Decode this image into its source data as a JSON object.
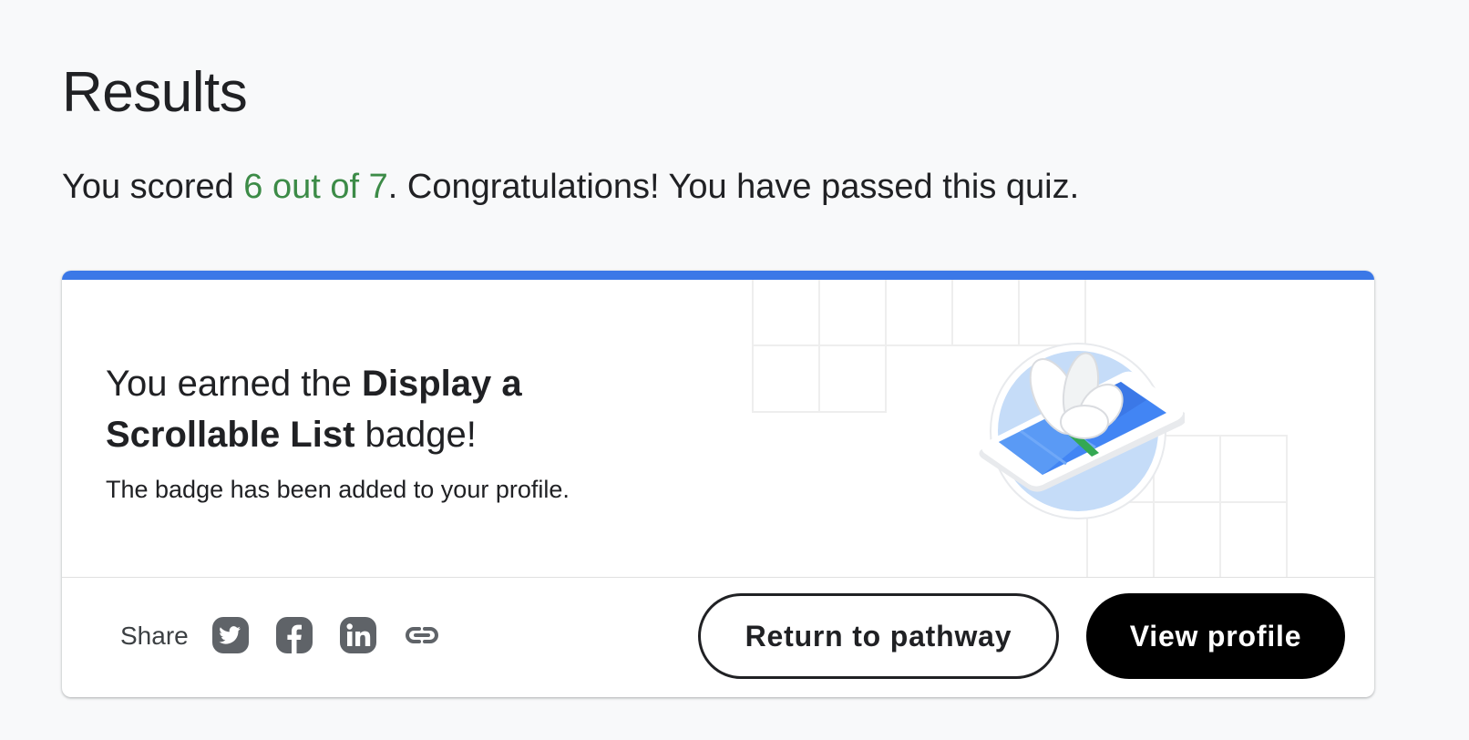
{
  "results": {
    "title": "Results",
    "score_prefix": "You scored ",
    "score_value": "6 out of 7",
    "score_suffix": ". Congratulations! You have passed this quiz."
  },
  "badge_card": {
    "accent_color": "#3b78e7",
    "earned_prefix": "You earned the ",
    "badge_name": "Display a Scrollable List",
    "earned_suffix": " badge!",
    "added_text": "The badge has been added to your profile.",
    "badge_icon": "phone-with-flower-badge"
  },
  "footer": {
    "share_label": "Share",
    "share_icons": [
      "twitter-icon",
      "facebook-icon",
      "linkedin-icon",
      "link-icon"
    ],
    "return_button": "Return to pathway",
    "profile_button": "View profile"
  },
  "colors": {
    "score_green": "#3c8b47",
    "background": "#f8f9fa",
    "icon_gray": "#5f6368"
  }
}
